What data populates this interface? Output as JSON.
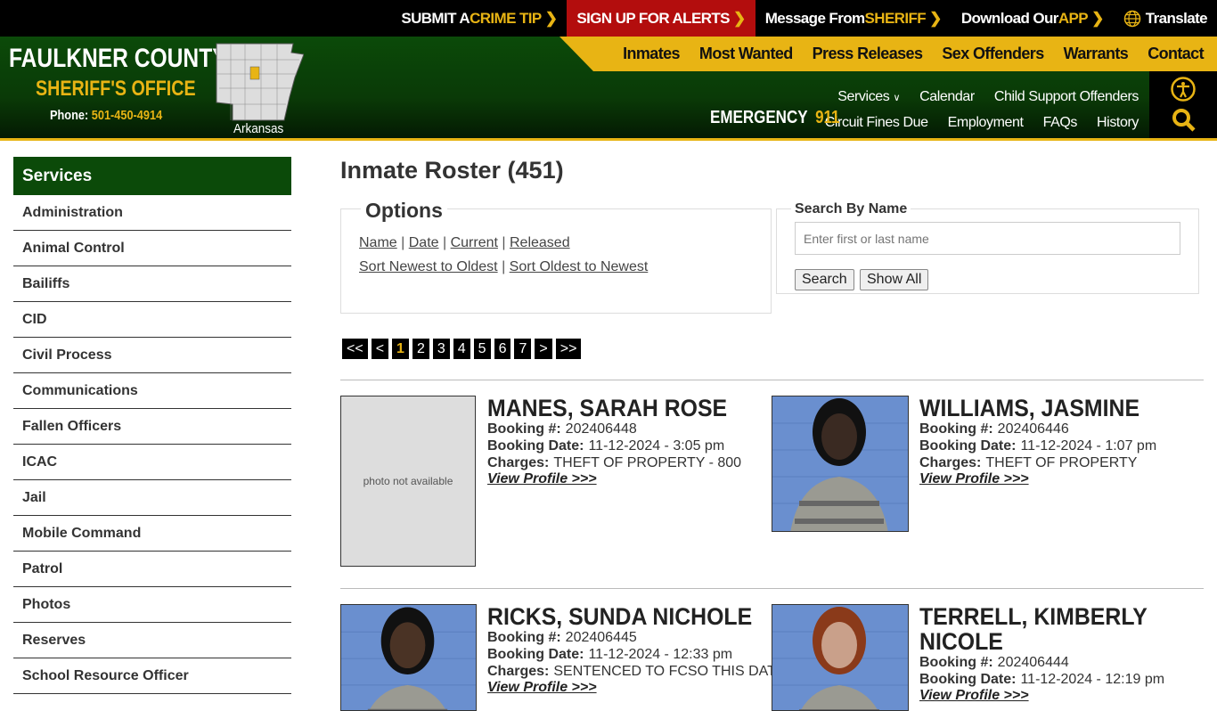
{
  "topbar": {
    "items": [
      {
        "pre": "SUBMIT A ",
        "hl": "CRIME TIP"
      },
      {
        "pre": "SIGN UP FOR ALERTS",
        "hl": ""
      },
      {
        "pre": "Message From ",
        "hl": "SHERIFF"
      },
      {
        "pre": "Download Our ",
        "hl": "APP"
      }
    ],
    "translate": "Translate"
  },
  "logo": {
    "line1": "FAULKNER COUNTY",
    "line2": "SHERIFF'S OFFICE",
    "phone_label": "Phone:",
    "phone": "501-450-4914",
    "map_label": "Arkansas"
  },
  "primary_nav": [
    "Inmates",
    "Most Wanted",
    "Press Releases",
    "Sex Offenders",
    "Warrants",
    "Contact"
  ],
  "secondary_nav": {
    "row1": [
      "Services",
      "Calendar",
      "Child Support Offenders"
    ],
    "row2": [
      "Circuit Fines Due",
      "Employment",
      "FAQs",
      "History"
    ]
  },
  "emergency": {
    "label": "EMERGENCY",
    "number": "911"
  },
  "sidebar": {
    "title": "Services",
    "items": [
      "Administration",
      "Animal Control",
      "Bailiffs",
      "CID",
      "Civil Process",
      "Communications",
      "Fallen Officers",
      "ICAC",
      "Jail",
      "Mobile Command",
      "Patrol",
      "Photos",
      "Reserves",
      "School Resource Officer"
    ]
  },
  "main": {
    "title": "Inmate Roster (451)",
    "options": {
      "legend": "Options",
      "filters": [
        "Name",
        "Date",
        "Current",
        "Released"
      ],
      "sorts": [
        "Sort Newest to Oldest",
        "Sort Oldest to Newest"
      ]
    },
    "search": {
      "legend": "Search By Name",
      "placeholder": "Enter first or last name",
      "search_label": "Search",
      "show_all_label": "Show All"
    },
    "pager": [
      "<<",
      "<",
      "1",
      "2",
      "3",
      "4",
      "5",
      "6",
      "7",
      ">",
      ">>"
    ],
    "current_page": "1",
    "labels": {
      "booking": "Booking #:",
      "date": "Booking Date:",
      "charges": "Charges:",
      "view": "View Profile >>>",
      "no_photo": "photo not available"
    },
    "inmates": [
      {
        "name": "MANES, SARAH ROSE",
        "booking": "202406448",
        "date": "11-12-2024 - 3:05 pm",
        "charges": "THEFT OF PROPERTY - 800",
        "photo": false
      },
      {
        "name": "WILLIAMS, JASMINE",
        "booking": "202406446",
        "date": "11-12-2024 - 1:07 pm",
        "charges": "THEFT OF PROPERTY",
        "photo": true
      },
      {
        "name": "RICKS, SUNDA NICHOLE",
        "booking": "202406445",
        "date": "11-12-2024 - 12:33 pm",
        "charges": "SENTENCED TO FCSO THIS DATE",
        "photo": true
      },
      {
        "name": "TERRELL, KIMBERLY NICOLE",
        "booking": "202406444",
        "date": "11-12-2024 - 12:19 pm",
        "charges": "",
        "photo": true
      }
    ]
  },
  "colors": {
    "green": "#0b4a09",
    "gold": "#e8b414",
    "alert_red": "#b30d0d"
  }
}
